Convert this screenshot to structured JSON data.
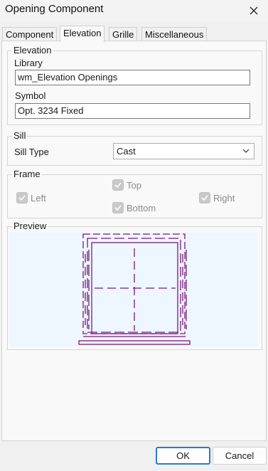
{
  "window": {
    "title": "Opening Component"
  },
  "tabs": [
    {
      "label": "Component"
    },
    {
      "label": "Elevation"
    },
    {
      "label": "Grille"
    },
    {
      "label": "Miscellaneous"
    }
  ],
  "elevation": {
    "group_label": "Elevation",
    "library_label": "Library",
    "library_value": "wm_Elevation Openings",
    "symbol_label": "Symbol",
    "symbol_value": "Opt. 3234 Fixed"
  },
  "sill": {
    "group_label": "Sill",
    "type_label": "Sill Type",
    "type_value": "Cast"
  },
  "frame": {
    "group_label": "Frame",
    "left": {
      "label": "Left",
      "checked": true,
      "enabled": false
    },
    "top": {
      "label": "Top",
      "checked": true,
      "enabled": false
    },
    "right": {
      "label": "Right",
      "checked": true,
      "enabled": false
    },
    "bottom": {
      "label": "Bottom",
      "checked": true,
      "enabled": false
    }
  },
  "preview": {
    "group_label": "Preview",
    "line_color": "#7a1a7a",
    "background_color": "#eef6ff"
  },
  "buttons": {
    "ok_label": "OK",
    "cancel_label": "Cancel"
  },
  "icons": {
    "close": "close-icon",
    "dropdown": "chevron-down-icon",
    "check": "check-icon"
  }
}
